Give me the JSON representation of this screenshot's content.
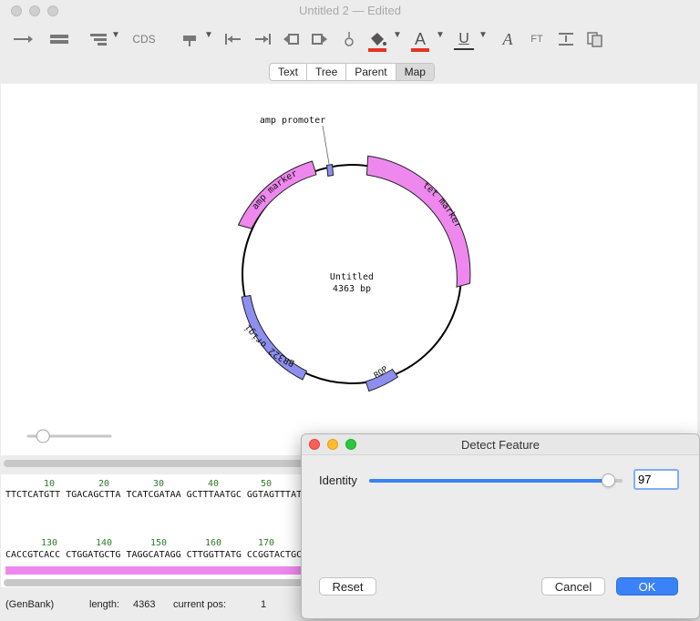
{
  "window": {
    "title": "Untitled 2 — Edited"
  },
  "toolbar": {
    "cds_label": "CDS",
    "ft_label": "FT"
  },
  "tabs": [
    {
      "label": "Text",
      "active": false
    },
    {
      "label": "Tree",
      "active": false
    },
    {
      "label": "Parent",
      "active": false
    },
    {
      "label": "Map",
      "active": true
    }
  ],
  "plasmid": {
    "name": "Untitled",
    "length_label": "4363 bp",
    "features": [
      {
        "label": "amp promoter"
      },
      {
        "label": "tet marker"
      },
      {
        "label": "amp marker"
      },
      {
        "label": "pBR322 origin"
      },
      {
        "label": "ROP"
      }
    ],
    "zoom_level": 0.18
  },
  "sequence": {
    "row1_numbers": [
      "10",
      "20",
      "30",
      "40",
      "50"
    ],
    "row1_text": "TTCTCATGTT TGACAGCTTA TCATCGATAA GCTTTAATGC GGTAGTTTAT CACAG",
    "row2_numbers": [
      "130",
      "140",
      "150",
      "160",
      "170"
    ],
    "row2_text": "CACCGTCACC CTGGATGCTG TAGGCATAGG CTTGGTTATG CCGGTACTGC CGGGC"
  },
  "status": {
    "format": "(GenBank)",
    "length_label": "length:",
    "length_value": "4363",
    "pos_label": "current pos:",
    "pos_value": "1"
  },
  "dialog": {
    "title": "Detect Feature",
    "identity_label": "Identity",
    "identity_value": "97",
    "slider_level": 0.97,
    "reset_label": "Reset",
    "cancel_label": "Cancel",
    "ok_label": "OK"
  },
  "colors": {
    "feature_pink": "#ee88ee",
    "feature_blue": "#8d8ff0",
    "accent_red": "#e53423",
    "ok_blue": "#3a82f7"
  }
}
